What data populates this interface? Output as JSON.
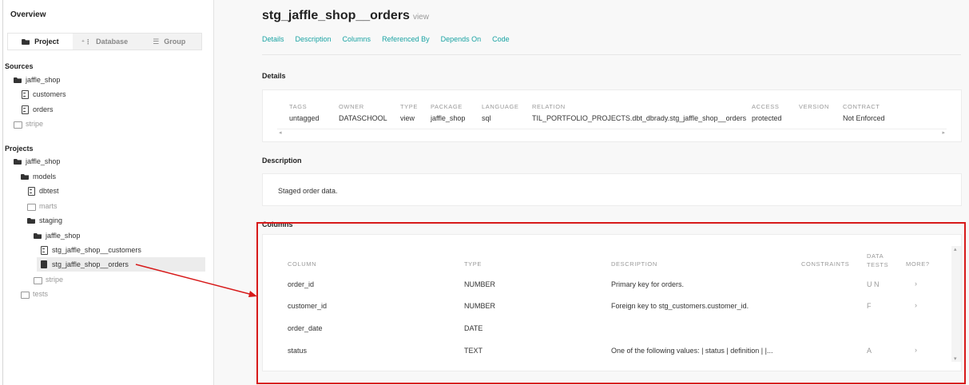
{
  "sidebar": {
    "overview": "Overview",
    "tabs": [
      "Project",
      "Database",
      "Group"
    ],
    "sources_label": "Sources",
    "projects_label": "Projects",
    "sources": [
      {
        "label": "jaffle_shop",
        "icon": "folder-open-icon"
      },
      {
        "label": "customers",
        "icon": "file-icon"
      },
      {
        "label": "orders",
        "icon": "file-icon"
      },
      {
        "label": "stripe",
        "icon": "folder-icon"
      }
    ],
    "projects": [
      {
        "label": "jaffle_shop",
        "icon": "folder-open-icon"
      },
      {
        "label": "models",
        "icon": "folder-open-icon"
      },
      {
        "label": "dbtest",
        "icon": "file-icon"
      },
      {
        "label": "marts",
        "icon": "folder-icon"
      },
      {
        "label": "staging",
        "icon": "folder-open-icon"
      },
      {
        "label": "jaffle_shop",
        "icon": "folder-open-icon"
      },
      {
        "label": "stg_jaffle_shop__customers",
        "icon": "file-icon"
      },
      {
        "label": "stg_jaffle_shop__orders",
        "icon": "file-solid-icon"
      },
      {
        "label": "stripe",
        "icon": "folder-icon"
      },
      {
        "label": "tests",
        "icon": "folder-icon"
      }
    ]
  },
  "main": {
    "title": "stg_jaffle_shop__orders",
    "title_suffix": "view",
    "tabs": [
      "Details",
      "Description",
      "Columns",
      "Referenced By",
      "Depends On",
      "Code"
    ],
    "details_heading": "Details",
    "details": {
      "labels": [
        "TAGS",
        "OWNER",
        "TYPE",
        "PACKAGE",
        "LANGUAGE",
        "RELATION",
        "ACCESS",
        "VERSION",
        "CONTRACT"
      ],
      "values": [
        "untagged",
        "DATASCHOOL",
        "view",
        "jaffle_shop",
        "sql",
        "TIL_PORTFOLIO_PROJECTS.dbt_dbrady.stg_jaffle_shop__orders",
        "protected",
        "",
        "Not Enforced"
      ]
    },
    "description_heading": "Description",
    "description": "Staged order data.",
    "columns_heading": "Columns",
    "columns": {
      "headers": [
        "COLUMN",
        "TYPE",
        "DESCRIPTION",
        "CONSTRAINTS",
        "DATA TESTS",
        "MORE?"
      ],
      "rows": [
        {
          "name": "order_id",
          "type": "NUMBER",
          "description": "Primary key for orders.",
          "tests": "U N",
          "more": "›"
        },
        {
          "name": "customer_id",
          "type": "NUMBER",
          "description": "Foreign key to stg_customers.customer_id.",
          "tests": "F",
          "more": "›"
        },
        {
          "name": "order_date",
          "type": "DATE",
          "description": "",
          "tests": "",
          "more": ""
        },
        {
          "name": "status",
          "type": "TEXT",
          "description": "One of the following values: | status | definition | |...",
          "tests": "A",
          "more": "›"
        }
      ]
    }
  },
  "colors": {
    "accent": "#1aa3a3",
    "highlight": "#d71a1a"
  }
}
